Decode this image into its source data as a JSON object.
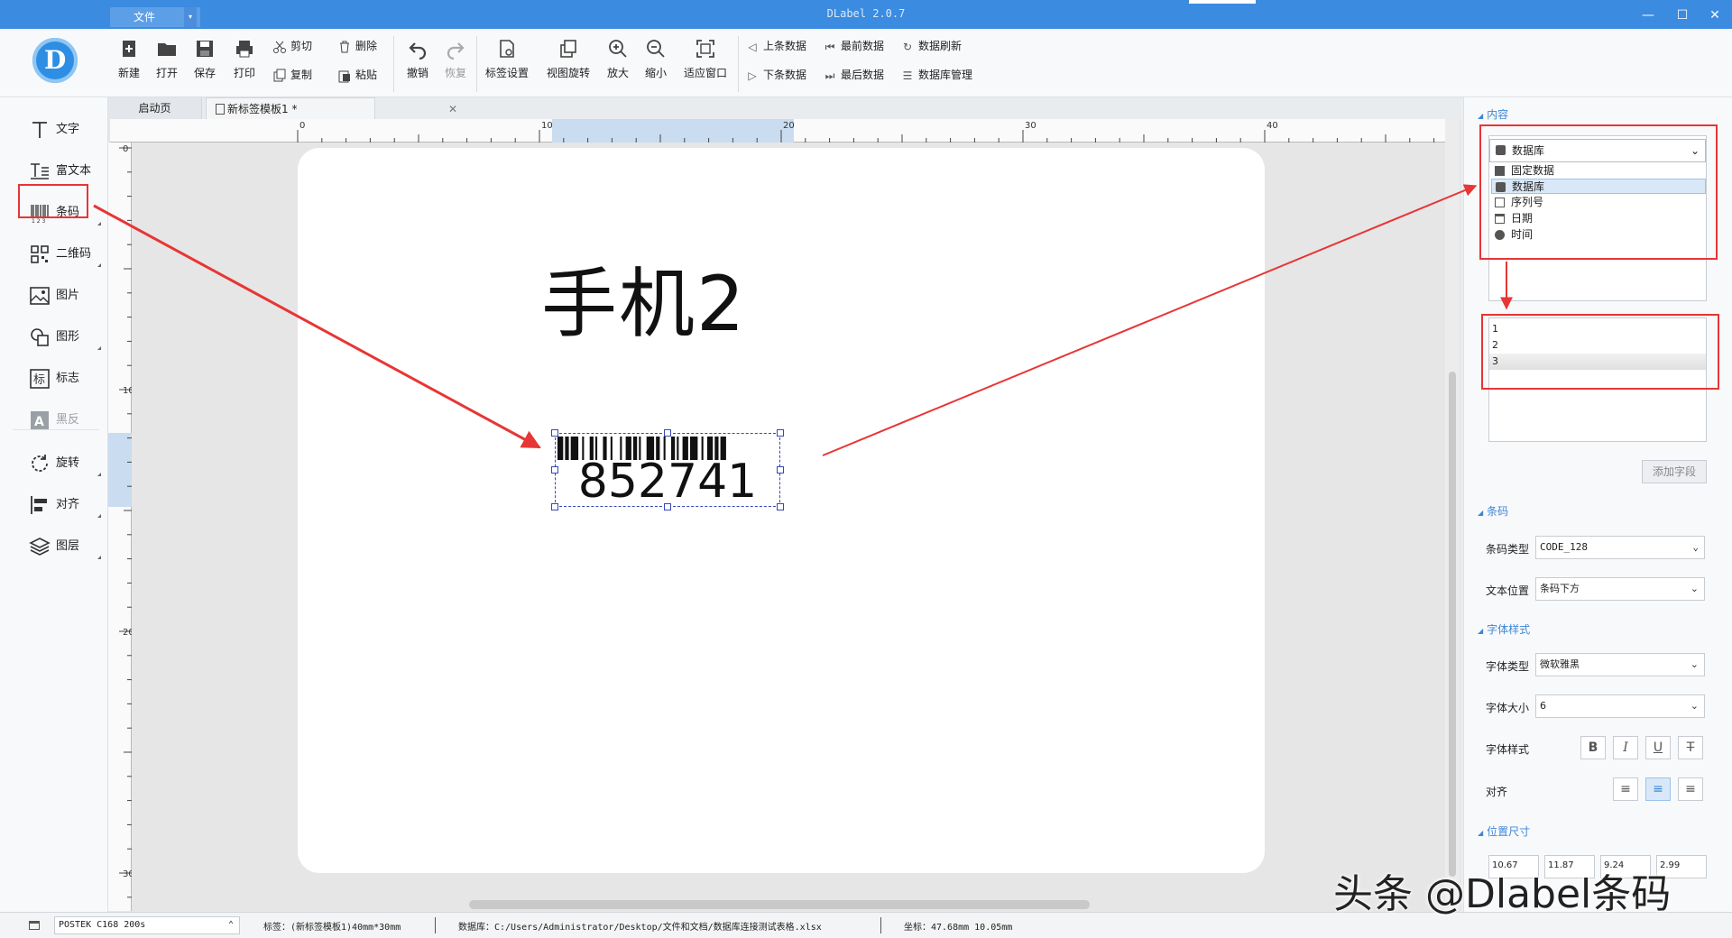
{
  "titlebar": {
    "file_menu": "文件",
    "app_title": "DLabel 2.0.7",
    "minimize": "—",
    "maximize": "☐",
    "close": "✕"
  },
  "toolbar": {
    "new": "新建",
    "open": "打开",
    "save": "保存",
    "print": "打印",
    "cut": "剪切",
    "copy": "复制",
    "delete": "删除",
    "paste": "粘贴",
    "undo": "撤销",
    "redo": "恢复",
    "label_settings": "标签设置",
    "view_rotate": "视图旋转",
    "zoom_in": "放大",
    "zoom_out": "缩小",
    "fit_window": "适应窗口",
    "prev_record": "上条数据",
    "next_record": "下条数据",
    "first_record": "最前数据",
    "last_record": "最后数据",
    "refresh_data": "数据刷新",
    "db_manage": "数据库管理"
  },
  "tools": {
    "text": "文字",
    "richtext": "富文本",
    "barcode": "条码",
    "qrcode": "二维码",
    "image": "图片",
    "shape": "图形",
    "logo": "标志",
    "invert": "黑反",
    "rotate": "旋转",
    "align": "对齐",
    "layers": "图层"
  },
  "tabs": {
    "start": "启动页",
    "doc": "新标签模板1 *",
    "close": "✕"
  },
  "ruler": {
    "h": [
      "0",
      "10",
      "20",
      "30",
      "40"
    ],
    "v": [
      "0",
      "10",
      "20",
      "30"
    ]
  },
  "canvas": {
    "title_text": "手机2",
    "barcode_value": "852741"
  },
  "panel": {
    "content_title": "内容",
    "source_selected": "数据库",
    "source_options": [
      "固定数据",
      "数据库",
      "序列号",
      "日期",
      "时间"
    ],
    "field_list": [
      "1",
      "2",
      "3"
    ],
    "add_field": "添加字段",
    "barcode_title": "条码",
    "barcode_type_label": "条码类型",
    "barcode_type": "CODE_128",
    "text_pos_label": "文本位置",
    "text_pos": "条码下方",
    "font_title": "字体样式",
    "font_type_label": "字体类型",
    "font_type": "微软雅黑",
    "font_size_label": "字体大小",
    "font_size": "6",
    "font_style_label": "字体样式",
    "align_label": "对齐",
    "position_title": "位置尺寸",
    "pos_values": [
      "10.67",
      "11.87",
      "9.24",
      "2.99"
    ]
  },
  "status": {
    "printer": "POSTEK C168 200s",
    "label_info": "标签：(新标签模板1)40mm*30mm",
    "db_path": "数据库：C:/Users/Administrator/Desktop/文件和文档/数据库连接测试表格.xlsx",
    "coords": "坐标：47.68mm 10.05mm"
  },
  "watermark": "头条 @Dlabel条码",
  "colors": {
    "titlebar": "#3b8be0",
    "accent": "#3d87d8",
    "highlight": "#e83535"
  }
}
